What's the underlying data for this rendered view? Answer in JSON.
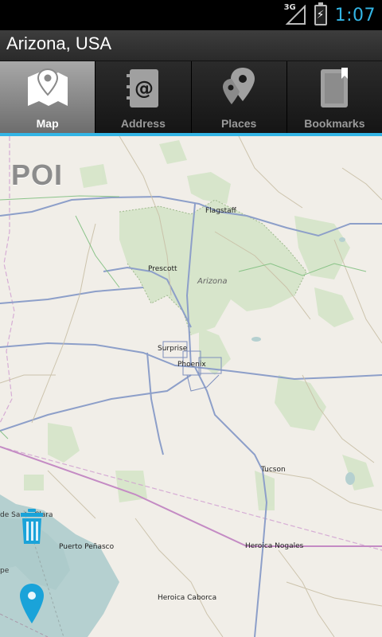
{
  "status": {
    "time": "1:07",
    "network": "3G"
  },
  "title": "Arizona, USA",
  "tabs": [
    {
      "label": "Map",
      "icon": "map-icon",
      "active": true
    },
    {
      "label": "Address",
      "icon": "address-book-icon",
      "active": false
    },
    {
      "label": "Places",
      "icon": "places-pins-icon",
      "active": false
    },
    {
      "label": "Bookmarks",
      "icon": "bookmark-icon",
      "active": false
    }
  ],
  "map": {
    "poi_label": "POI",
    "places": {
      "flagstaff": "Flagstaff",
      "prescott": "Prescott",
      "arizona": "Arizona",
      "surprise": "Surprise",
      "phoenix": "Phoenix",
      "tucson": "Tucson",
      "puerto_penasco": "Puerto Peñasco",
      "heroica_nogales": "Heroica Nogales",
      "heroica_caborca": "Heroica Caborca",
      "santa_clara_partial": "de Santa Clara",
      "pe_partial": "pe"
    }
  },
  "colors": {
    "accent": "#33b5e5",
    "map_bg": "#f1eee8",
    "water": "#b5d0d0",
    "roads": "#8d9fc9"
  }
}
